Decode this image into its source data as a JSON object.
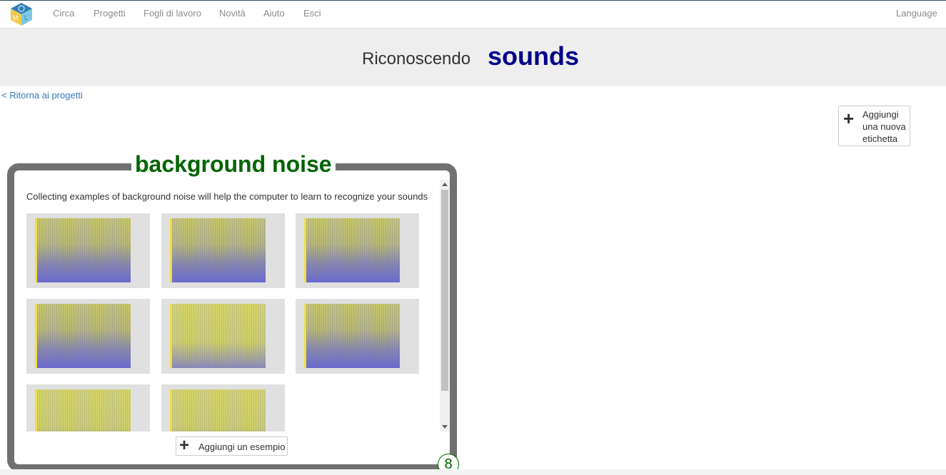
{
  "nav": {
    "items": [
      {
        "label": "Circa"
      },
      {
        "label": "Progetti"
      },
      {
        "label": "Fogli di lavoro"
      },
      {
        "label": "Novità"
      },
      {
        "label": "Aiuto"
      },
      {
        "label": "Esci"
      }
    ],
    "language": "Language"
  },
  "header": {
    "prefix": "Riconoscendo",
    "project_name": "sounds"
  },
  "back_link": "< Ritorna ai progetti",
  "add_label_button": "Aggiungi una nuova etichetta",
  "bucket": {
    "label": "background noise",
    "hint": "Collecting examples of background noise will help the computer to learn to recognize your sounds",
    "example_count": "8",
    "add_example_button": "Aggiungi un esempio"
  },
  "colors": {
    "nav_text": "#8c8c8c",
    "title_blue": "#00008b",
    "label_green": "#006400",
    "link_blue": "#337ab7",
    "bucket_border": "#707070"
  }
}
